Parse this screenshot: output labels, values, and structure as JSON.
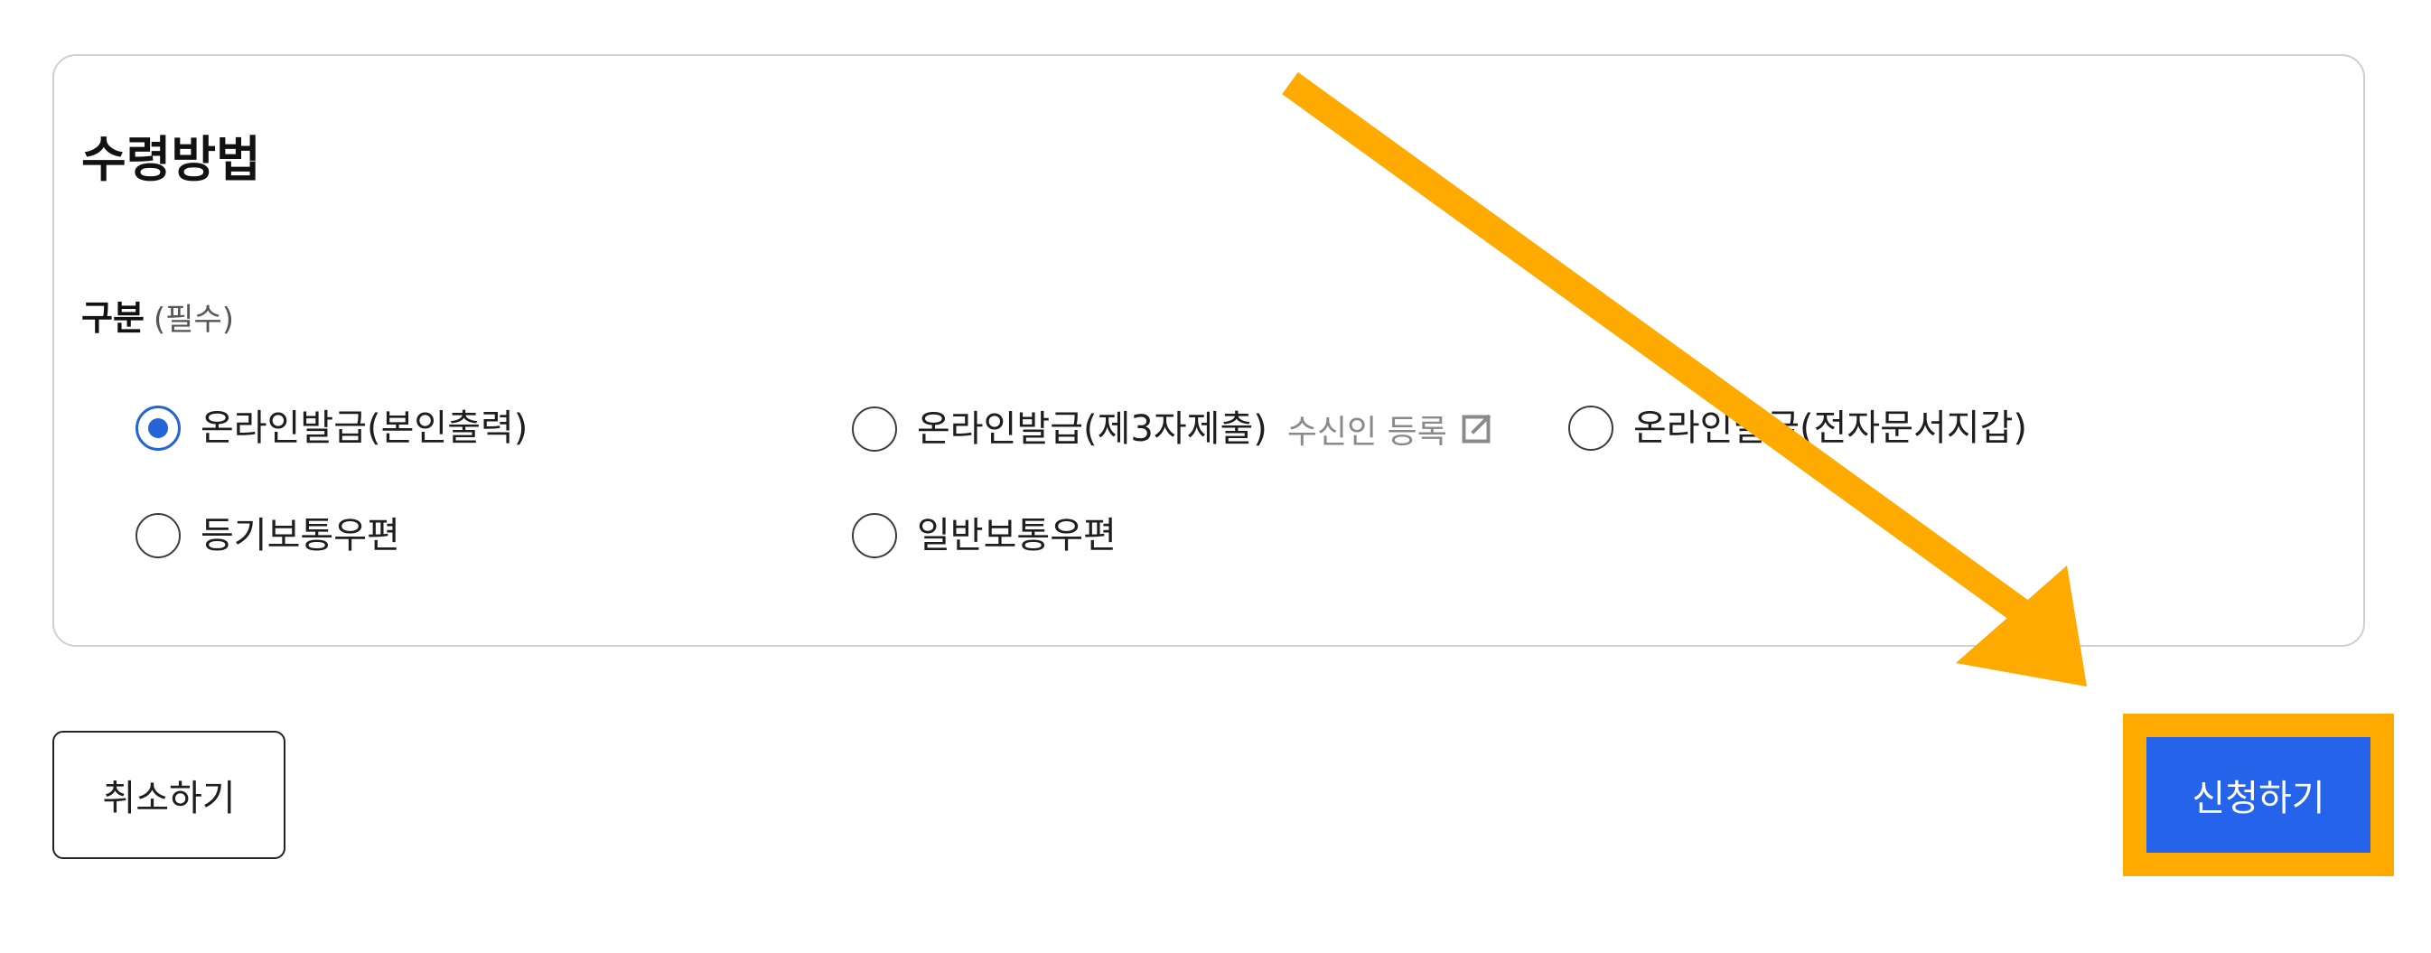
{
  "section": {
    "title": "수령방법",
    "field_label": "구분",
    "field_required": "(필수)"
  },
  "options": [
    {
      "label": "온라인발급(본인출력)",
      "checked": true
    },
    {
      "label": "온라인발급(제3자제출)",
      "checked": false,
      "link_label": "수신인 등록",
      "link_icon": "external-link-icon"
    },
    {
      "label": "온라인발급(전자문서지갑)",
      "checked": false
    },
    {
      "label": "등기보통우편",
      "checked": false
    },
    {
      "label": "일반보통우편",
      "checked": false
    }
  ],
  "buttons": {
    "cancel": "취소하기",
    "apply": "신청하기"
  },
  "annotation": {
    "color": "#ffaa00",
    "type": "arrow-and-highlight-box"
  },
  "colors": {
    "accent": "#2563eb",
    "annotation": "#ffaa00",
    "muted_text": "#8a8a8a"
  }
}
